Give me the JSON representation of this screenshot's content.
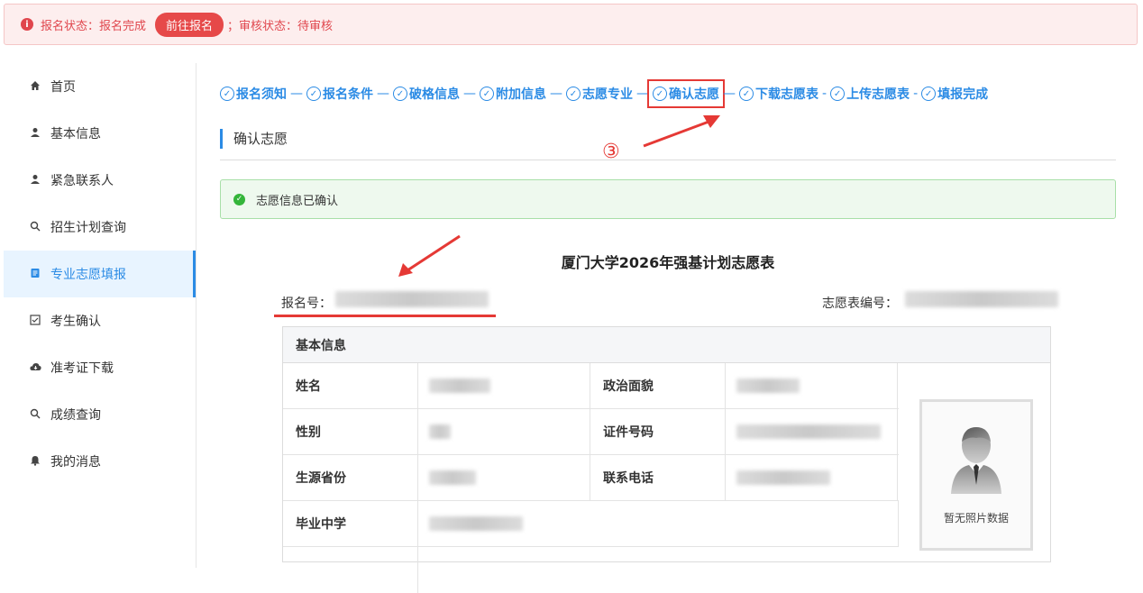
{
  "alert": {
    "status_text": "报名状态：报名完成",
    "goto_button": "前往报名",
    "review_text": "；审核状态：待审核"
  },
  "sidebar": {
    "items": [
      {
        "label": "首页",
        "icon": "home-icon"
      },
      {
        "label": "基本信息",
        "icon": "user-icon"
      },
      {
        "label": "紧急联系人",
        "icon": "user-icon"
      },
      {
        "label": "招生计划查询",
        "icon": "search-icon"
      },
      {
        "label": "专业志愿填报",
        "icon": "document-icon"
      },
      {
        "label": "考生确认",
        "icon": "checkbox-icon"
      },
      {
        "label": "准考证下载",
        "icon": "cloud-download-icon"
      },
      {
        "label": "成绩查询",
        "icon": "search-icon"
      },
      {
        "label": "我的消息",
        "icon": "bell-icon"
      }
    ],
    "active_index": 4
  },
  "steps": [
    {
      "label": "报名须知"
    },
    {
      "label": "报名条件"
    },
    {
      "label": "破格信息"
    },
    {
      "label": "附加信息"
    },
    {
      "label": "志愿专业"
    },
    {
      "label": "确认志愿"
    },
    {
      "label": "下载志愿表"
    },
    {
      "label": "上传志愿表"
    },
    {
      "label": "填报完成"
    }
  ],
  "section_title": "确认志愿",
  "annotation_number": "③",
  "success_message": "志愿信息已确认",
  "form": {
    "title": "厦门大学2026年强基计划志愿表",
    "registration_label": "报名号：",
    "form_number_label": "志愿表编号："
  },
  "table": {
    "header": "基本信息",
    "labels": {
      "name": "姓名",
      "political": "政治面貌",
      "gender": "性别",
      "id_number": "证件号码",
      "province": "生源省份",
      "phone": "联系电话",
      "school": "毕业中学"
    },
    "no_photo": "暂无照片数据"
  },
  "colors": {
    "accent": "#2b8be5",
    "alert_red": "#e0464d",
    "annotation_red": "#e53935",
    "success_green": "#34b53a"
  }
}
